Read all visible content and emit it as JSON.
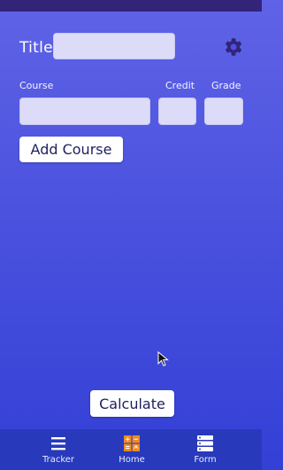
{
  "form": {
    "title_label": "Title:",
    "title_value": "",
    "headers": {
      "course": "Course",
      "credit": "Credit",
      "grade": "Grade"
    },
    "course_value": "",
    "credit_value": "",
    "grade_value": "",
    "add_course_label": "Add Course",
    "calculate_label": "Calculate",
    "settings_icon": "gear-icon"
  },
  "nav": {
    "items": [
      {
        "label": "Tracker",
        "icon": "menu-icon"
      },
      {
        "label": "Home",
        "icon": "calculator-icon"
      },
      {
        "label": "Form",
        "icon": "server-list-icon"
      }
    ]
  },
  "colors": {
    "background_top": "#5f63e6",
    "background_bottom": "#3340d6",
    "status_bar": "#33247a",
    "nav_bar": "#2839bc",
    "input_fill": "#dcdcf8",
    "home_icon_orange": "#f08a24"
  }
}
